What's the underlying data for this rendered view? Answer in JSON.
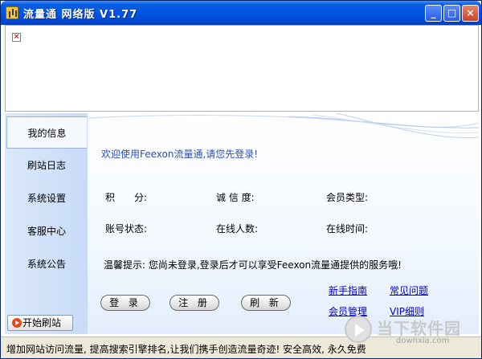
{
  "window": {
    "title": "流量通 网络版 V1.77",
    "minimize": "_",
    "maximize": "□",
    "close": "×"
  },
  "banner": {
    "broken_image_glyph": "×"
  },
  "sidebar": {
    "items": [
      {
        "label": "我的信息"
      },
      {
        "label": "刷站日志"
      },
      {
        "label": "系统设置"
      },
      {
        "label": "客服中心"
      },
      {
        "label": "系统公告"
      }
    ],
    "start_button": "开始刷站"
  },
  "main": {
    "welcome": "欢迎使用Feexon流量通,请您先登录!",
    "fields": {
      "points": "积　　分:",
      "credit": "诚 信 度:",
      "member_type": "会员类型:",
      "account_status": "账号状态:",
      "online_users": "在线人数:",
      "online_time": "在线时间:"
    },
    "tip": "温馨提示: 您尚未登录,登录后才可以享受Feexon流量通提供的服务哦!",
    "buttons": {
      "login": "登 录",
      "register": "注 册",
      "refresh": "刷 新"
    },
    "links": {
      "guide": "新手指南",
      "faq": "常见问题",
      "member_admin": "会员管理",
      "vip_rules": "VIP细则"
    }
  },
  "statusbar": {
    "text": "增加网站访问流量, 提高搜索引擎排名,让我们携手创造流量奇迹!  安全高效, 永久免费"
  },
  "watermark": {
    "title": "当下软件园",
    "url": "downxia.com"
  }
}
